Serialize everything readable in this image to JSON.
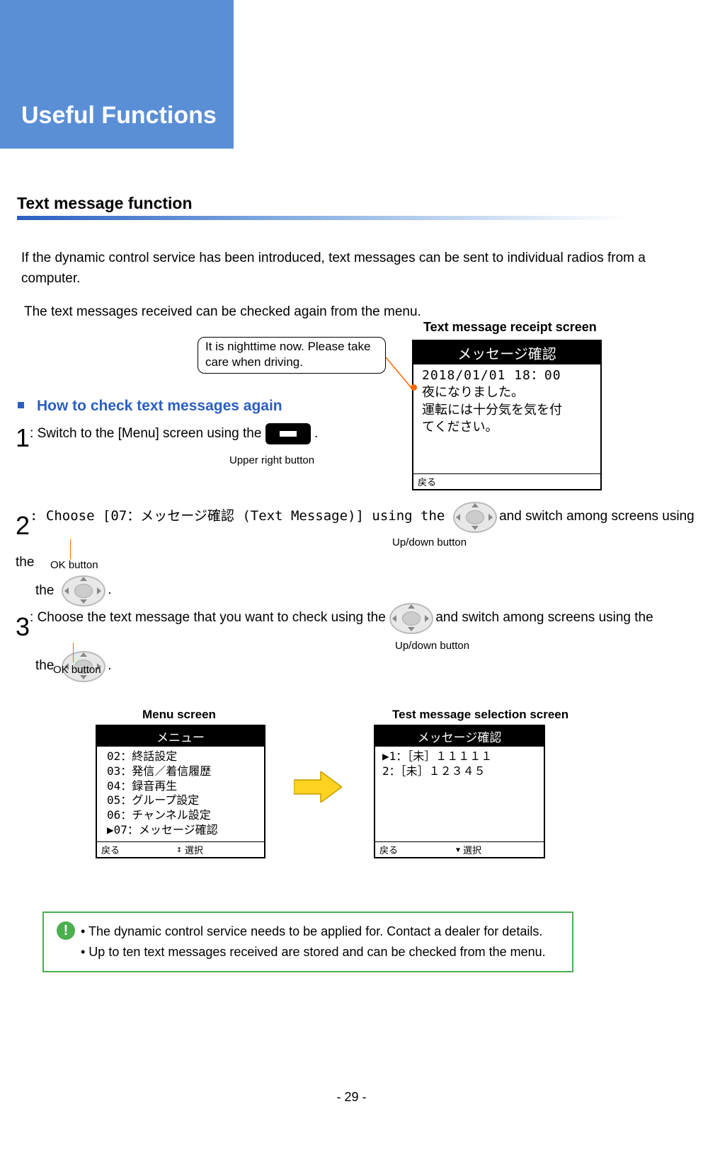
{
  "chapter_title": "Useful Functions",
  "section_title": "Text message function",
  "intro_text": "  If the dynamic control service has been introduced, text messages can be sent to individual radios from a computer.",
  "intro_text2": "The text messages received can be checked again from the menu.",
  "speech_box": "It is nighttime now. Please take care when driving.",
  "receipt_caption": "Text message receipt screen",
  "receipt_header": "メッセージ確認",
  "receipt_date": "2018/01/01  18：00",
  "receipt_line1": "夜になりました。",
  "receipt_line2": "運転には十分気を気を付",
  "receipt_line3": "てください。",
  "receipt_footer_left": "戻る",
  "sub_heading": "How to check text messages again",
  "step1_pre": ": Switch to the [Menu] screen using the ",
  "step1_post": " .",
  "label_upper_right": "Upper right button",
  "step2_pre": ": Choose [07：メッセージ確認  (Text Message)] using the ",
  "step2_mid": "  and switch among screens using the ",
  "step2_post": " .",
  "label_updown": "Up/down button",
  "label_ok": "OK button",
  "step3_pre": ": Choose the text message that you want to check using the ",
  "step3_mid": "  and switch among screens using the ",
  "step3_post": " .",
  "menu_caption": "Menu screen",
  "sel_caption": "Test message selection screen",
  "menu_header": "メニュー",
  "menu_items": [
    " 02：終話設定",
    " 03：発信／着信履歴",
    " 04：録音再生",
    " 05：グループ設定",
    " 06：チャンネル設定",
    "▶07：メッセージ確認"
  ],
  "menu_footer_left": "戻る",
  "menu_footer_center": "選択",
  "sel_header": "メッセージ確認",
  "sel_items": [
    "▶1：［未］１１１１１",
    " 2：［未］１２３４５"
  ],
  "sel_footer_left": "戻る",
  "sel_footer_center": "選択",
  "info_bullet1": "• The dynamic control service needs to be applied for. Contact a dealer for details.",
  "info_bullet2": "• Up to ten text messages received are stored and can be checked from the menu.",
  "page_number": "- 29 -"
}
